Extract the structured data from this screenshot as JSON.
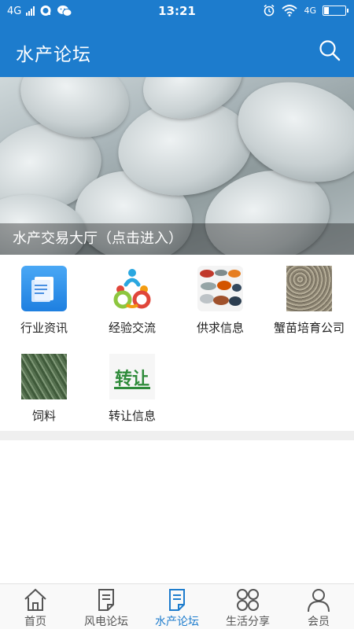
{
  "status_bar": {
    "network_left": "4G",
    "time": "13:21",
    "network_right": "4G",
    "battery_level": 0.22
  },
  "header": {
    "title": "水产论坛"
  },
  "banner": {
    "caption": "水产交易大厅（点击进入）"
  },
  "categories": [
    {
      "label": "行业资讯",
      "icon": "document-app-icon"
    },
    {
      "label": "经验交流",
      "icon": "people-exchange-icon"
    },
    {
      "label": "供求信息",
      "icon": "seafood-collage-icon"
    },
    {
      "label": "蟹苗培育公司",
      "icon": "crab-seedling-photo-icon"
    },
    {
      "label": "饲料",
      "icon": "feed-pellets-photo-icon"
    },
    {
      "label": "转让信息",
      "icon": "transfer-text-icon",
      "icon_text": "转让"
    }
  ],
  "bottom_nav": [
    {
      "label": "首页",
      "icon": "home-icon",
      "active": false
    },
    {
      "label": "风电论坛",
      "icon": "note-icon",
      "active": false
    },
    {
      "label": "水产论坛",
      "icon": "note-icon",
      "active": true
    },
    {
      "label": "生活分享",
      "icon": "four-circles-icon",
      "active": false
    },
    {
      "label": "会员",
      "icon": "user-icon",
      "active": false
    }
  ],
  "colors": {
    "primary": "#1d7ccd",
    "nav_inactive": "#555555",
    "divider": "#efefef"
  }
}
